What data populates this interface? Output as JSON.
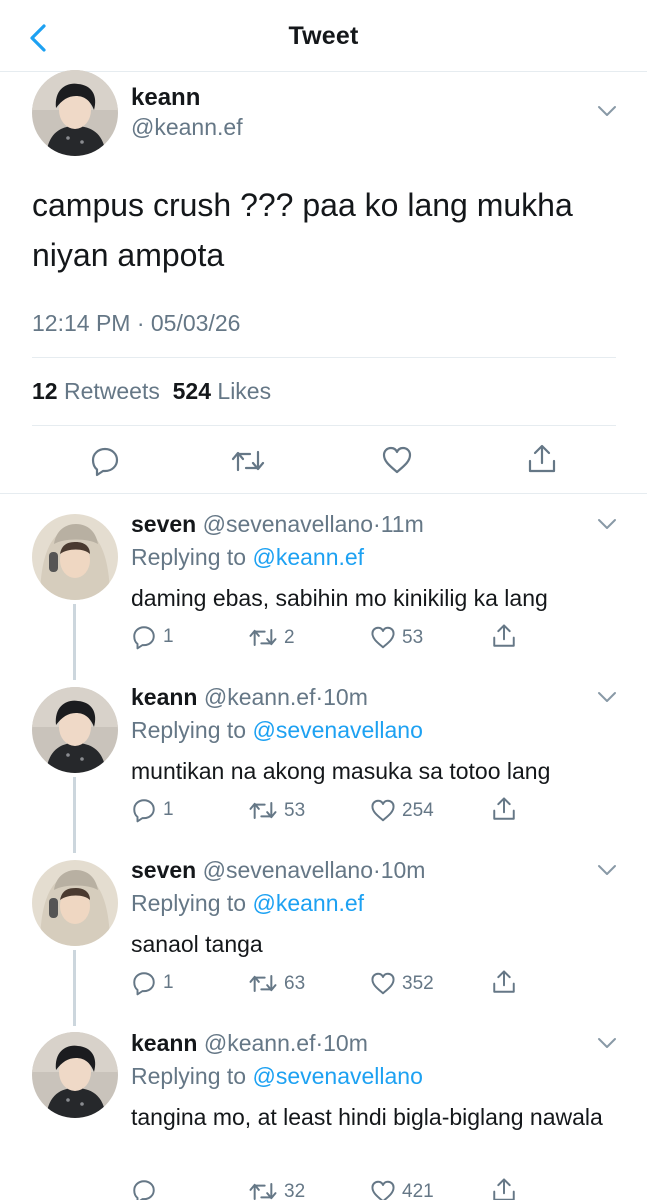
{
  "header": {
    "title": "Tweet"
  },
  "tweet": {
    "name": "keann",
    "handle": "@keann.ef",
    "text": "campus crush ??? paa ko lang mukha niyan ampota",
    "timestamp": "12:14 PM · 05/03/26",
    "retweets_count": "12",
    "retweets_label": "Retweets",
    "likes_count": "524",
    "likes_label": "Likes"
  },
  "replies": [
    {
      "name": "seven",
      "handle": "@sevenavellano",
      "sep": "·",
      "time": "11m",
      "replying_prefix": "Replying to",
      "replying_to": "@keann.ef",
      "text": "daming ebas, sabihin mo kinikilig ka lang",
      "reply_count": "1",
      "retweet_count": "2",
      "like_count": "53"
    },
    {
      "name": "keann",
      "handle": "@keann.ef",
      "sep": "·",
      "time": "10m",
      "replying_prefix": "Replying to",
      "replying_to": "@sevenavellano",
      "text": "muntikan na akong masuka sa totoo lang",
      "reply_count": "1",
      "retweet_count": "53",
      "like_count": "254"
    },
    {
      "name": "seven",
      "handle": "@sevenavellano",
      "sep": "·",
      "time": "10m",
      "replying_prefix": "Replying to",
      "replying_to": "@keann.ef",
      "text": "sanaol tanga",
      "reply_count": "1",
      "retweet_count": "63",
      "like_count": "352"
    },
    {
      "name": "keann",
      "handle": "@keann.ef",
      "sep": "·",
      "time": "10m",
      "replying_prefix": "Replying to",
      "replying_to": "@sevenavellano",
      "text": "tangina mo, at least hindi bigla-biglang nawala",
      "reply_count": "",
      "retweet_count": "32",
      "like_count": "421"
    }
  ],
  "icons": {
    "back": "chevron-left-icon",
    "more": "chevron-down-icon",
    "reply": "speech-bubble-icon",
    "retweet": "retweet-icon",
    "like": "heart-icon",
    "share": "share-icon"
  },
  "colors": {
    "accent": "#1da1f2",
    "secondary_text": "#657786",
    "divider": "#e6ecf0"
  }
}
